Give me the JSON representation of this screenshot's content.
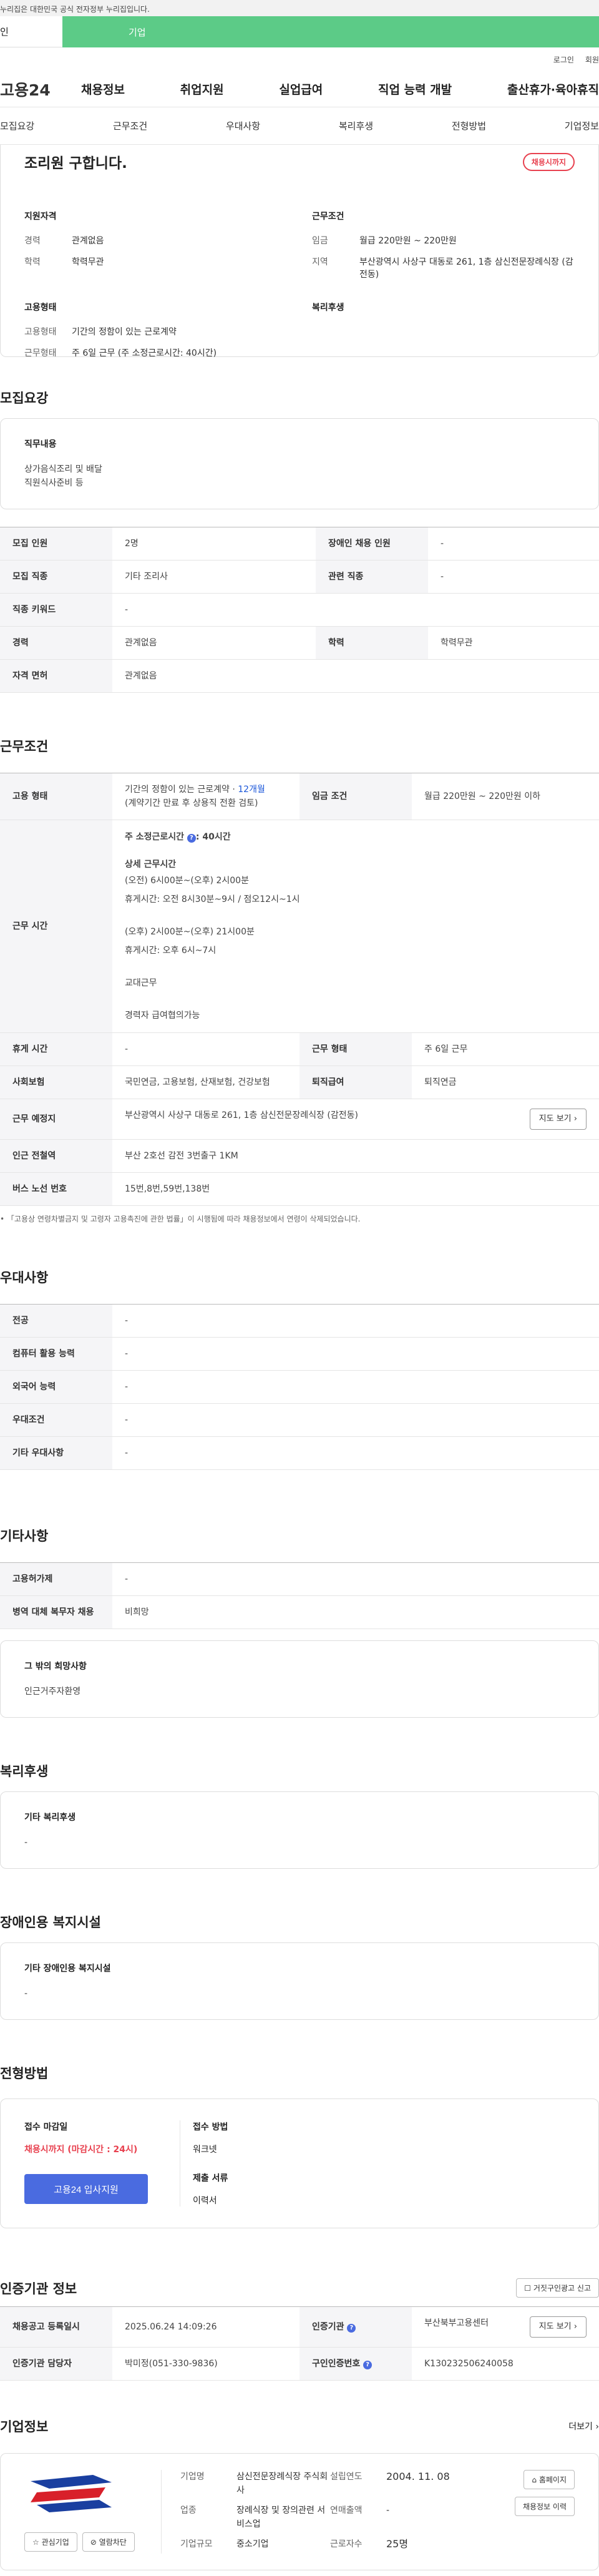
{
  "gov_bar": "누리집은 대한민국 공식 전자정부 누리집입니다.",
  "top_tabs": {
    "individual": "인",
    "business": "기업"
  },
  "util": {
    "login": "로그인",
    "signup": "회원"
  },
  "gnb": {
    "logo": "고용24",
    "items": [
      "채용정보",
      "취업지원",
      "실업급여",
      "직업 능력 개발",
      "출산휴가·육아휴직"
    ]
  },
  "sub_nav": [
    "모집요강",
    "근무조건",
    "우대사항",
    "복리후생",
    "전형방법",
    "기업정보"
  ],
  "summary": {
    "title": "조리원 구합니다.",
    "badge": "채용시까지",
    "qual": {
      "heading": "지원자격",
      "rows": [
        {
          "k": "경력",
          "v": "관계없음"
        },
        {
          "k": "학력",
          "v": "학력무관"
        }
      ]
    },
    "cond": {
      "heading": "근무조건",
      "rows": [
        {
          "k": "임금",
          "v": "월급 220만원 ~ 220만원"
        },
        {
          "k": "지역",
          "v": "부산광역시 사상구 대동로 261, 1층 삼신전문장례식장 (감전동)"
        }
      ]
    },
    "emp": {
      "heading": "고용형태",
      "rows": [
        {
          "k": "고용형태",
          "v": "기간의 정함이 있는 근로계약"
        },
        {
          "k": "근무형태",
          "v": "주 6일 근무 (주 소정근로시간: 40시간)"
        }
      ]
    },
    "welfare": {
      "heading": "복리후생"
    }
  },
  "recruit": {
    "title": "모집요강",
    "duty_heading": "직무내용",
    "duty_lines": [
      "상가음식조리 및 배달",
      "직원식사준비 등"
    ],
    "rows": [
      [
        {
          "k": "모집 인원",
          "v": "2명"
        },
        {
          "k": "장애인 채용 인원",
          "v": "-"
        }
      ],
      [
        {
          "k": "모집 직종",
          "v": "기타 조리사"
        },
        {
          "k": "관련 직종",
          "v": "-"
        }
      ],
      [
        {
          "k": "직종 키워드",
          "v": "-"
        }
      ],
      [
        {
          "k": "경력",
          "v": "관계없음"
        },
        {
          "k": "학력",
          "v": "학력무관"
        }
      ],
      [
        {
          "k": "자격 면허",
          "v": "관계없음"
        }
      ]
    ]
  },
  "work": {
    "title": "근무조건",
    "emp_type_label": "고용 형태",
    "emp_type_val": "기간의 정함이 있는 근로계약 · ",
    "emp_type_months": "12개월",
    "emp_type_note": "(계약기간 만료 후 상용직 전환 검토)",
    "wage_label": "임금 조건",
    "wage_val": "월급 220만원 ~ 220만원 이하",
    "hours_label": "근무 시간",
    "hours_weekly": "주 소정근로시간",
    "hours_weekly_val": ": 40시간",
    "hours_detail_heading": "상세 근무시간",
    "hours_lines": [
      "(오전) 6시00분~(오후) 2시00분",
      "휴게시간: 오전 8시30분~9시 / 점오12시~1시",
      "",
      "(오후) 2시00분~(오후) 21시00분",
      "휴게시간: 오후 6시~7시",
      "",
      "교대근무",
      "",
      "경력자 급여협의가능"
    ],
    "rows": [
      [
        {
          "k": "휴게 시간",
          "v": "-"
        },
        {
          "k": "근무 형태",
          "v": "주 6일 근무"
        }
      ],
      [
        {
          "k": "사회보험",
          "v": "국민연금, 고용보험, 산재보험, 건강보험"
        },
        {
          "k": "퇴직급여",
          "v": "퇴직연금"
        }
      ]
    ],
    "place_label": "근무 예정지",
    "place_val": "부산광역시 사상구 대동로 261, 1층 삼신전문장례식장 (감전동)",
    "map_btn": "지도 보기",
    "subway_label": "인근 전철역",
    "subway_val": "부산 2호선 감전 3번출구 1KM",
    "bus_label": "버스 노선 번호",
    "bus_val": "15번,8번,59번,138번",
    "note": "「고용상 연령차별금지 및 고령자 고용촉진에 관한 법률」이 시행됨에 따라 채용정보에서 연령이 삭제되었습니다."
  },
  "pref": {
    "title": "우대사항",
    "rows": [
      {
        "k": "전공",
        "v": "-"
      },
      {
        "k": "컴퓨터 활용 능력",
        "v": "-"
      },
      {
        "k": "외국어 능력",
        "v": "-"
      },
      {
        "k": "우대조건",
        "v": "-"
      },
      {
        "k": "기타 우대사항",
        "v": "-"
      }
    ]
  },
  "etc": {
    "title": "기타사항",
    "rows": [
      {
        "k": "고용허가제",
        "v": "-"
      },
      {
        "k": "병역 대체 복무자 채용",
        "v": "비희망"
      }
    ],
    "wish_heading": "그 밖의 희망사항",
    "wish_val": "인근거주자환영"
  },
  "benefit": {
    "title": "복리후생",
    "heading": "기타 복리후생",
    "val": "-"
  },
  "disabled": {
    "title": "장애인용 복지시설",
    "heading": "기타 장애인용 복지시설",
    "val": "-"
  },
  "apply": {
    "title": "전형방법",
    "deadline_heading": "접수 마감일",
    "deadline_val": "채용시까지 (마감시간 : 24시)",
    "button": "고용24 입사지원",
    "method_heading": "접수 방법",
    "method_val": "워크넷",
    "docs_heading": "제출 서류",
    "docs_val": "이력서"
  },
  "cert": {
    "title": "인증기관 정보",
    "report_btn": "거짓구인광고 신고",
    "rows": [
      [
        {
          "k": "채용공고 등록일시",
          "v": "2025.06.24 14:09:26"
        },
        {
          "k": "인증기관",
          "v": "부산북부고용센터"
        }
      ],
      [
        {
          "k": "인증기관 담당자",
          "v": "박미정(051-330-9836)"
        },
        {
          "k": "구인인증번호",
          "v": "K130232506240058"
        }
      ]
    ],
    "map_btn": "지도 보기"
  },
  "company": {
    "title": "기업정보",
    "more": "더보기",
    "fav_btn": "관심기업",
    "block_btn": "열람차단",
    "fields": [
      {
        "k": "기업명",
        "v": "삼신전문장례식장 주식회사"
      },
      {
        "k": "설립연도",
        "v": "2004. 11. 08"
      },
      {
        "k": "업종",
        "v": "장례식장 및 장의관련 서비스업"
      },
      {
        "k": "연매출액",
        "v": "-"
      },
      {
        "k": "기업규모",
        "v": "중소기업"
      },
      {
        "k": "근로자수",
        "v": "25명"
      }
    ],
    "homepage_btn": "홈페이지",
    "list_btn": "채용정보 이력"
  },
  "colors": {
    "accent": "#4a6be0",
    "brand_green": "#5ccb87",
    "deadline_red": "#e8414f"
  }
}
